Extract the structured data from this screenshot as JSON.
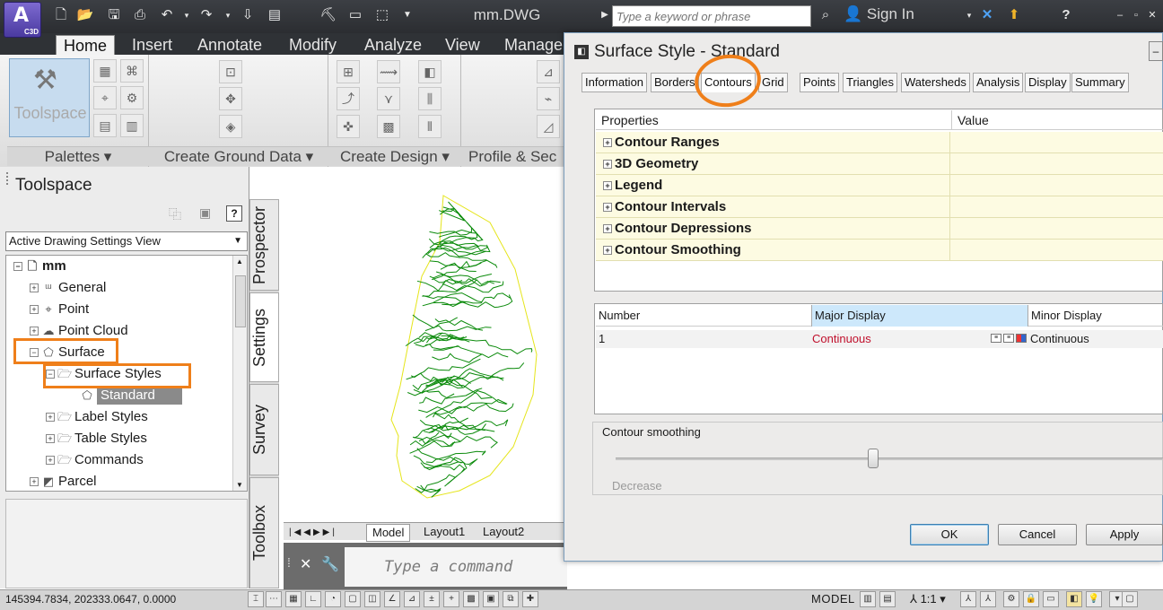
{
  "app": {
    "badge": "C3D",
    "file_name": "mm.DWG"
  },
  "search": {
    "placeholder": "Type a keyword or phrase"
  },
  "account": {
    "sign_in": "Sign In"
  },
  "ribbon": {
    "tabs": [
      "Home",
      "Insert",
      "Annotate",
      "Modify",
      "Analyze",
      "View",
      "Manage"
    ],
    "active_tab": "Home",
    "panels": [
      "Palettes",
      "Create Ground Data",
      "Create Design",
      "Profile & Sec"
    ],
    "toolspace_button": "Toolspace"
  },
  "toolspace": {
    "title": "Toolspace",
    "view": "Active Drawing Settings View",
    "tree": {
      "root": "mm",
      "items": [
        {
          "label": "General",
          "icon": "general-icon"
        },
        {
          "label": "Point",
          "icon": "point-icon"
        },
        {
          "label": "Point Cloud",
          "icon": "point-cloud-icon"
        },
        {
          "label": "Surface",
          "icon": "surface-icon"
        },
        {
          "label": "Surface Styles",
          "icon": "folder-icon"
        },
        {
          "label": "Standard",
          "icon": "style-icon"
        },
        {
          "label": "Label Styles",
          "icon": "folder-icon"
        },
        {
          "label": "Table Styles",
          "icon": "folder-icon"
        },
        {
          "label": "Commands",
          "icon": "folder-icon"
        },
        {
          "label": "Parcel",
          "icon": "parcel-icon"
        }
      ]
    },
    "vertical_tabs": [
      "Prospector",
      "Settings",
      "Survey",
      "Toolbox"
    ]
  },
  "layout_tabs": [
    "Model",
    "Layout1",
    "Layout2"
  ],
  "command_line": {
    "placeholder": "Type a command"
  },
  "status_bar": {
    "coordinates": "145394.7834, 202333.0647, 0.0000",
    "space": "MODEL",
    "scale": "1:1"
  },
  "dialog": {
    "title": "Surface Style - Standard",
    "tabs": [
      "Information",
      "Borders",
      "Contours",
      "Grid",
      "Points",
      "Triangles",
      "Watersheds",
      "Analysis",
      "Display",
      "Summary"
    ],
    "active_tab": "Contours",
    "properties": {
      "header_property": "Properties",
      "header_value": "Value",
      "rows": [
        "Contour Ranges",
        "3D Geometry",
        "Legend",
        "Contour Intervals",
        "Contour Depressions",
        "Contour Smoothing"
      ]
    },
    "table": {
      "headers": [
        "Number",
        "Major Display",
        "Minor Display"
      ],
      "rows": [
        {
          "number": "1",
          "major": "Continuous",
          "minor": "Continuous"
        }
      ]
    },
    "smoothing": {
      "label": "Contour smoothing",
      "min_label": "Decrease",
      "value_fraction": 0.47
    },
    "buttons": {
      "ok": "OK",
      "cancel": "Cancel",
      "apply": "Apply"
    }
  },
  "colors": {
    "highlight": "#ef7f1a",
    "contours": "#0a8a0a",
    "boundary": "#e5e51a",
    "major_text": "#c0102c"
  }
}
